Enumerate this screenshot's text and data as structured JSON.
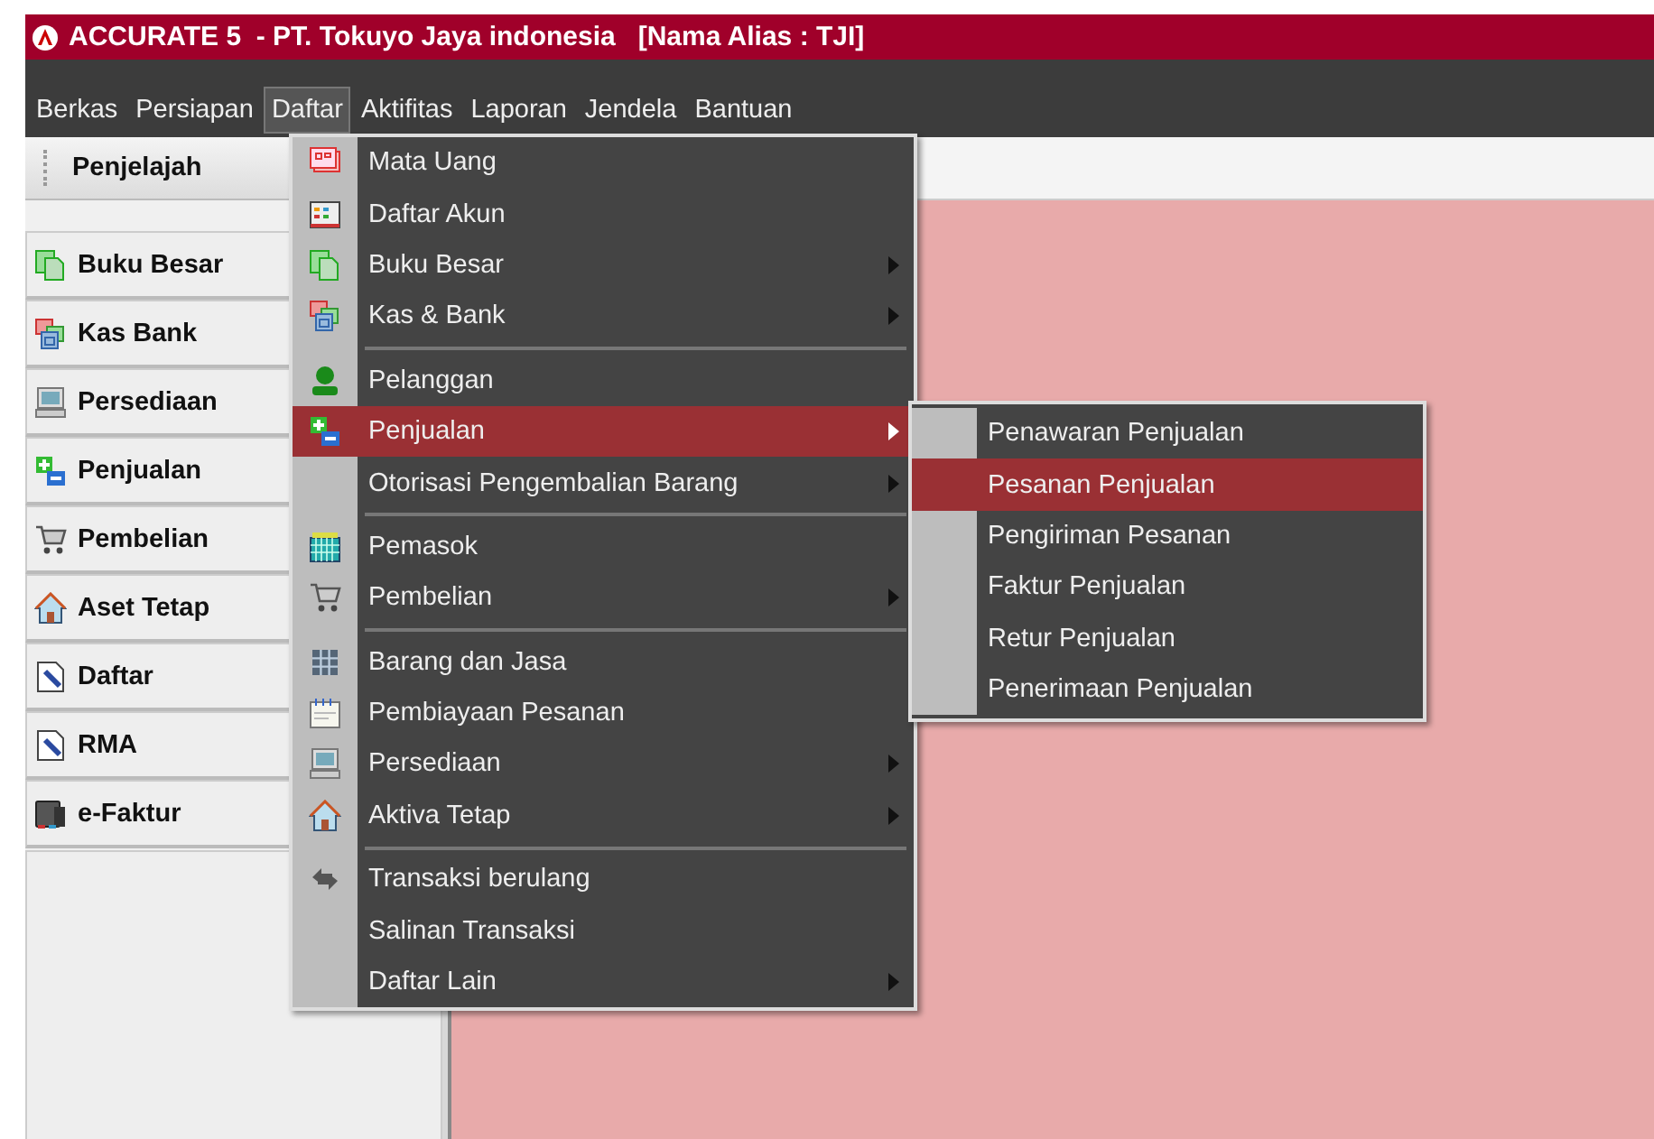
{
  "window": {
    "title": "ACCURATE 5  - PT. Tokuyo Jaya indonesia   [Nama Alias : TJI]"
  },
  "menu_bar": [
    {
      "label": "Berkas",
      "selected": false
    },
    {
      "label": "Persiapan",
      "selected": false
    },
    {
      "label": "Daftar",
      "selected": true
    },
    {
      "label": "Aktifitas",
      "selected": false
    },
    {
      "label": "Laporan",
      "selected": false
    },
    {
      "label": "Jendela",
      "selected": false
    },
    {
      "label": "Bantuan",
      "selected": false
    }
  ],
  "explorer": {
    "title": "Penjelajah",
    "items": [
      {
        "label": "Buku Besar"
      },
      {
        "label": "Kas Bank"
      },
      {
        "label": "Persediaan"
      },
      {
        "label": "Penjualan"
      },
      {
        "label": "Pembelian"
      },
      {
        "label": "Aset Tetap"
      },
      {
        "label": "Daftar"
      },
      {
        "label": "RMA"
      },
      {
        "label": "e-Faktur"
      }
    ]
  },
  "dropdown_menu": [
    {
      "kind": "item",
      "label": "Mata Uang",
      "submenu": false,
      "selected": false
    },
    {
      "kind": "item",
      "label": "Daftar Akun",
      "submenu": false,
      "selected": false
    },
    {
      "kind": "item",
      "label": "Buku Besar",
      "submenu": true,
      "selected": false
    },
    {
      "kind": "item",
      "label": "Kas & Bank",
      "submenu": true,
      "selected": false
    },
    {
      "kind": "separator"
    },
    {
      "kind": "item",
      "label": "Pelanggan",
      "submenu": false,
      "selected": false
    },
    {
      "kind": "item",
      "label": "Penjualan",
      "submenu": true,
      "selected": true
    },
    {
      "kind": "item",
      "label": "Otorisasi Pengembalian Barang",
      "submenu": true,
      "selected": false
    },
    {
      "kind": "separator"
    },
    {
      "kind": "item",
      "label": "Pemasok",
      "submenu": false,
      "selected": false
    },
    {
      "kind": "item",
      "label": "Pembelian",
      "submenu": true,
      "selected": false
    },
    {
      "kind": "separator"
    },
    {
      "kind": "item",
      "label": "Barang dan Jasa",
      "submenu": false,
      "selected": false
    },
    {
      "kind": "item",
      "label": "Pembiayaan Pesanan",
      "submenu": false,
      "selected": false
    },
    {
      "kind": "item",
      "label": "Persediaan",
      "submenu": true,
      "selected": false
    },
    {
      "kind": "item",
      "label": "Aktiva Tetap",
      "submenu": true,
      "selected": false
    },
    {
      "kind": "separator"
    },
    {
      "kind": "item",
      "label": "Transaksi berulang",
      "submenu": false,
      "selected": false
    },
    {
      "kind": "item",
      "label": "Salinan Transaksi",
      "submenu": false,
      "selected": false
    },
    {
      "kind": "item",
      "label": "Daftar Lain",
      "submenu": true,
      "selected": false
    }
  ],
  "submenu": [
    {
      "label": "Penawaran Penjualan",
      "selected": false
    },
    {
      "label": "Pesanan Penjualan",
      "selected": true
    },
    {
      "label": "Pengiriman Pesanan",
      "selected": false
    },
    {
      "label": "Faktur Penjualan",
      "selected": false
    },
    {
      "label": "Retur Penjualan",
      "selected": false
    },
    {
      "label": "Penerimaan Penjualan",
      "selected": false
    }
  ]
}
